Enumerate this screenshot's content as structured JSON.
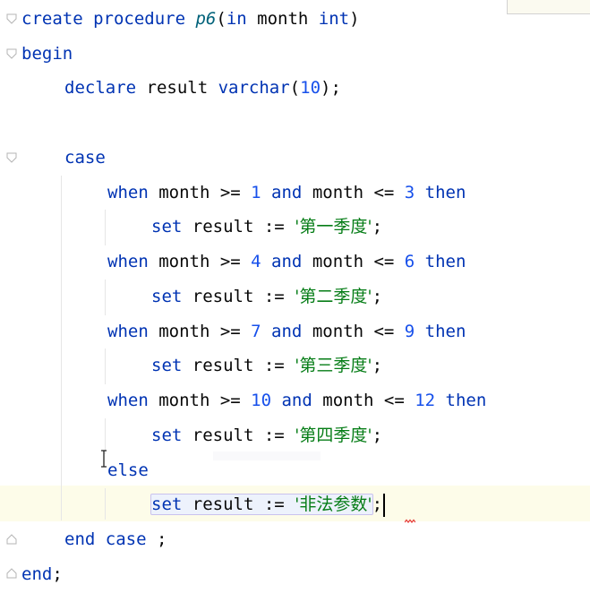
{
  "code": {
    "line1": {
      "kw1": "create procedure ",
      "fn": "p6",
      "p1": "(",
      "kw2": "in",
      "id": " month ",
      "kw3": "int",
      "p2": ")"
    },
    "line2": {
      "kw": "begin"
    },
    "line3": {
      "kw1": "declare",
      "id": " result ",
      "kw2": "varchar",
      "p1": "(",
      "num": "10",
      "p2": ");"
    },
    "line4": {
      "kw": "case"
    },
    "when1": {
      "kw1": "when",
      "a": " month >= ",
      "n1": "1",
      "kw2": " and",
      "b": " month <= ",
      "n2": "3",
      "kw3": " then"
    },
    "set1": {
      "kw": "set",
      "a": " result := ",
      "s": "'第一季度'",
      "e": ";"
    },
    "when2": {
      "kw1": "when",
      "a": " month >= ",
      "n1": "4",
      "kw2": " and",
      "b": " month <= ",
      "n2": "6",
      "kw3": " then"
    },
    "set2": {
      "kw": "set",
      "a": " result := ",
      "s": "'第二季度'",
      "e": ";"
    },
    "when3": {
      "kw1": "when",
      "a": " month >= ",
      "n1": "7",
      "kw2": " and",
      "b": " month <= ",
      "n2": "9",
      "kw3": " then"
    },
    "set3": {
      "kw": "set",
      "a": " result := ",
      "s": "'第三季度'",
      "e": ";"
    },
    "when4": {
      "kw1": "when",
      "a": " month >= ",
      "n1": "10",
      "kw2": " and",
      "b": " month <= ",
      "n2": "12",
      "kw3": " then"
    },
    "set4": {
      "kw": "set",
      "a": " result := ",
      "s": "'第四季度'",
      "e": ";"
    },
    "else": {
      "kw": "else"
    },
    "set5": {
      "kw": "set",
      "a": " result := ",
      "s": "'非法参数'",
      "e": ";"
    },
    "endcase": {
      "kw": "end case",
      "e": " ;"
    },
    "end": {
      "kw": "end",
      "e": ";"
    }
  },
  "colors": {
    "keyword": "#0033b3",
    "function": "#00627a",
    "number": "#1750eb",
    "string": "#067d17",
    "current_line": "#fdfce9"
  },
  "icons": [
    "fold-icon",
    "text-cursor-icon",
    "error-squiggle-icon"
  ]
}
